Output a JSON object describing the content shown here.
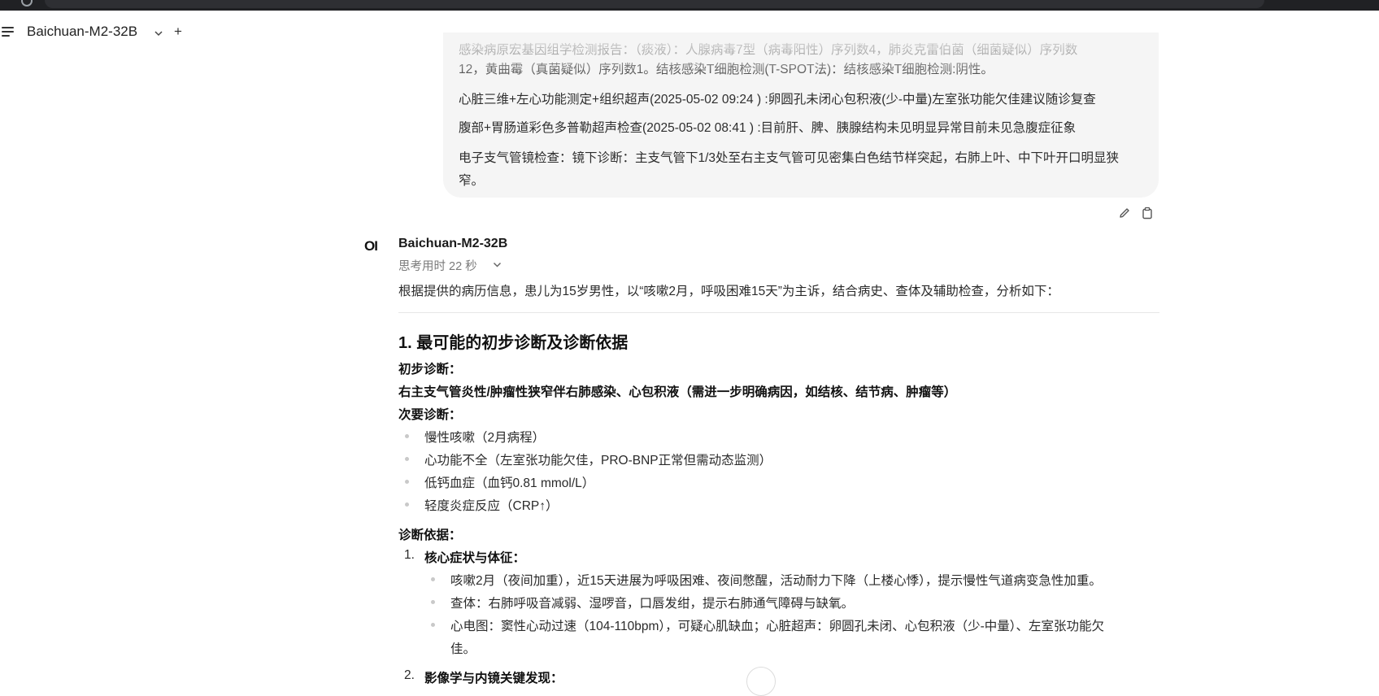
{
  "header": {
    "model_name": "Baichuan-M2-32B",
    "new_chat_label": "+"
  },
  "user_message": {
    "lines": [
      "感染病原宏基因组学检测报告：（痰液）：人腺病毒7型（病毒阳性）序列数4，肺炎克雷伯菌（细菌疑似）序列数",
      "12，黄曲霉（真菌疑似）序列数1。结核感染T细胞检测(T-SPOT法)：结核感染T细胞检测:阴性。",
      "心脏三维+左心功能测定+组织超声(2025-05-02 09:24 ) :卵圆孔未闭心包积液(少-中量)左室张功能欠佳建议随诊复查",
      "腹部+胃肠道彩色多普勒超声检查(2025-05-02 08:41 ) :目前肝、脾、胰腺结构未见明显异常目前未见急腹症征象",
      "电子支气管镜检查：镜下诊断：主支气管下1/3处至右主支气管可见密集白色结节样突起，右肺上叶、中下叶开口明显狭",
      "窄。"
    ]
  },
  "assistant": {
    "avatar_text": "OI",
    "name": "Baichuan-M2-32B",
    "thinking_label": "思考用时 22 秒",
    "intro": "根据提供的病历信息，患儿为15岁男性，以“咳嗽2月，呼吸困难15天”为主诉，结合病史、查体及辅助检查，分析如下：",
    "section_title": "1. 最可能的初步诊断及诊断依据",
    "preliminary_label": "初步诊断：",
    "preliminary_text": "右主支气管炎性/肿瘤性狭窄伴右肺感染、心包积液（需进一步明确病因，如结核、结节病、肿瘤等）",
    "secondary_label": "次要诊断：",
    "secondary_items": [
      "慢性咳嗽（2月病程）",
      "心功能不全（左室张功能欠佳，PRO-BNP正常但需动态监测）",
      "低钙血症（血钙0.81 mmol/L）",
      "轻度炎症反应（CRP↑）"
    ],
    "basis_label": "诊断依据：",
    "basis_items": [
      {
        "num": "1.",
        "title": "核心症状与体征：",
        "subs": [
          "咳嗽2月（夜间加重），近15天进展为呼吸困难、夜间憋醒，活动耐力下降（上楼心悸），提示慢性气道病变急性加重。",
          "查体：右肺呼吸音减弱、湿啰音，口唇发绀，提示右肺通气障碍与缺氧。",
          "心电图：窦性心动过速（104-110bpm），可疑心肌缺血；心脏超声：卵圆孔未闭、心包积液（少-中量）、左室张功能欠",
          "佳。"
        ]
      },
      {
        "num": "2.",
        "title": "影像学与内镜关键发现："
      }
    ]
  }
}
